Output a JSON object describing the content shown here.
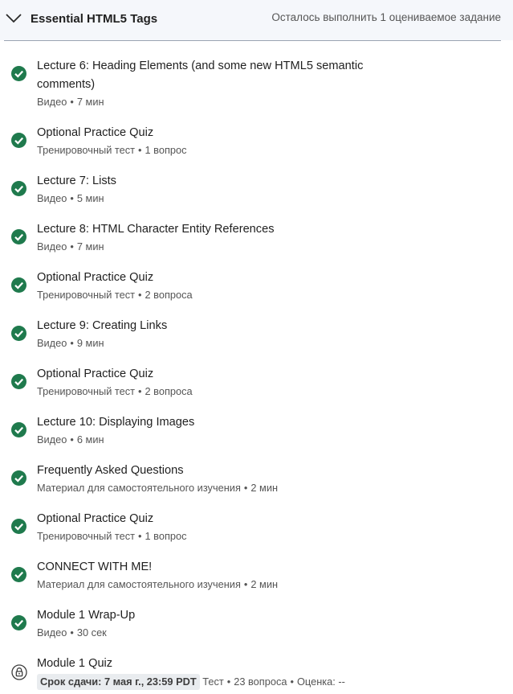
{
  "section": {
    "title": "Essential HTML5 Tags",
    "status": "Осталось выполнить 1 оцениваемое задание"
  },
  "items": [
    {
      "title": "Lecture 6: Heading Elements (and some new HTML5 semantic comments)",
      "type": "Видео",
      "detail": "7 мин",
      "status": "completed"
    },
    {
      "title": "Optional Practice Quiz",
      "type": "Тренировочный тест",
      "detail": "1 вопрос",
      "status": "completed"
    },
    {
      "title": "Lecture 7: Lists",
      "type": "Видео",
      "detail": "5 мин",
      "status": "completed"
    },
    {
      "title": "Lecture 8: HTML Character Entity References",
      "type": "Видео",
      "detail": "7 мин",
      "status": "completed"
    },
    {
      "title": "Optional Practice Quiz",
      "type": "Тренировочный тест",
      "detail": "2 вопроса",
      "status": "completed"
    },
    {
      "title": "Lecture 9: Creating Links",
      "type": "Видео",
      "detail": "9 мин",
      "status": "completed"
    },
    {
      "title": "Optional Practice Quiz",
      "type": "Тренировочный тест",
      "detail": "2 вопроса",
      "status": "completed"
    },
    {
      "title": "Lecture 10: Displaying Images",
      "type": "Видео",
      "detail": "6 мин",
      "status": "completed"
    },
    {
      "title": "Frequently Asked Questions",
      "type": "Материал для самостоятельного изучения",
      "detail": "2 мин",
      "status": "completed"
    },
    {
      "title": "Optional Practice Quiz",
      "type": "Тренировочный тест",
      "detail": "1 вопрос",
      "status": "completed"
    },
    {
      "title": "CONNECT WITH ME!",
      "type": "Материал для самостоятельного изучения",
      "detail": "2 мин",
      "status": "completed"
    },
    {
      "title": "Module 1 Wrap-Up",
      "type": "Видео",
      "detail": "30 сек",
      "status": "completed"
    }
  ],
  "quiz": {
    "title": "Module 1 Quiz",
    "due": "Срок сдачи: 7 мая г., 23:59 PDT",
    "type": "Тест",
    "questions": "23 вопроса",
    "grade": "Оценка: --",
    "status": "locked"
  },
  "colors": {
    "check": "#1f7a4d",
    "header_bg": "#f5f7fb"
  },
  "icons": {
    "chevron": "chevron-down-icon",
    "check": "check-circle-icon",
    "lock": "lock-icon"
  }
}
